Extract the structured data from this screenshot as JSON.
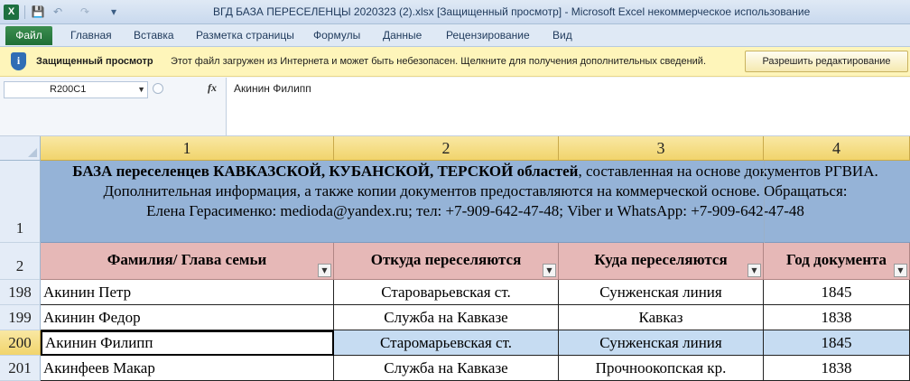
{
  "window": {
    "app_icon": "X",
    "title": "ВГД БАЗА ПЕРЕСЕЛЕНЦЫ 2020323 (2).xlsx  [Защищенный просмотр] - Microsoft Excel некоммерческое использование"
  },
  "ribbon": {
    "file_tab": "Файл",
    "tabs": [
      "Главная",
      "Вставка",
      "Разметка страницы",
      "Формулы",
      "Данные",
      "Рецензирование",
      "Вид"
    ]
  },
  "protected_view": {
    "title": "Защищенный просмотр",
    "message": "Этот файл загружен из Интернета и может быть небезопасен. Щелкните для получения дополнительных сведений.",
    "enable_button": "Разрешить редактирование"
  },
  "formula_bar": {
    "name_box": "R200C1",
    "fx": "fx",
    "value": "Акинин Филипп"
  },
  "sheet": {
    "columns": [
      "1",
      "2",
      "3",
      "4"
    ],
    "title_row_number": "1",
    "title": {
      "bold_part": "БАЗА переселенцев  КАВКАЗСКОЙ, КУБАНСКОЙ, ТЕРСКОЙ областей",
      "rest_line1": ", составленная на основе документов РГВИА.",
      "line2": "Дополнительная информация, а также копии документов предоставляются на коммерческой основе. Обращаться:",
      "line3": "Елена Герасименко: medioda@yandex.ru; тел: +7-909-642-47-48; Viber и WhatsApp: +7-909-642-47-48"
    },
    "header_row_number": "2",
    "headers": [
      "Фамилия/ Глава семьи",
      "Откуда переселяются",
      "Куда переселяются",
      "Год документа"
    ],
    "rows": [
      {
        "num": "198",
        "cells": [
          "Акинин Петр",
          "Староварьевская ст.",
          "Сунженская линия",
          "1845"
        ]
      },
      {
        "num": "199",
        "cells": [
          "Акинин Федор",
          "Служба на Кавказе",
          "Кавказ",
          "1838"
        ]
      },
      {
        "num": "200",
        "cells": [
          "Акинин Филипп",
          "Старомарьевская ст.",
          "Сунженская линия",
          "1845"
        ]
      },
      {
        "num": "201",
        "cells": [
          "Акинфеев Макар",
          "Служба на Кавказе",
          "Прочноокопская кр.",
          "1838"
        ]
      }
    ],
    "selected_row": "200"
  }
}
